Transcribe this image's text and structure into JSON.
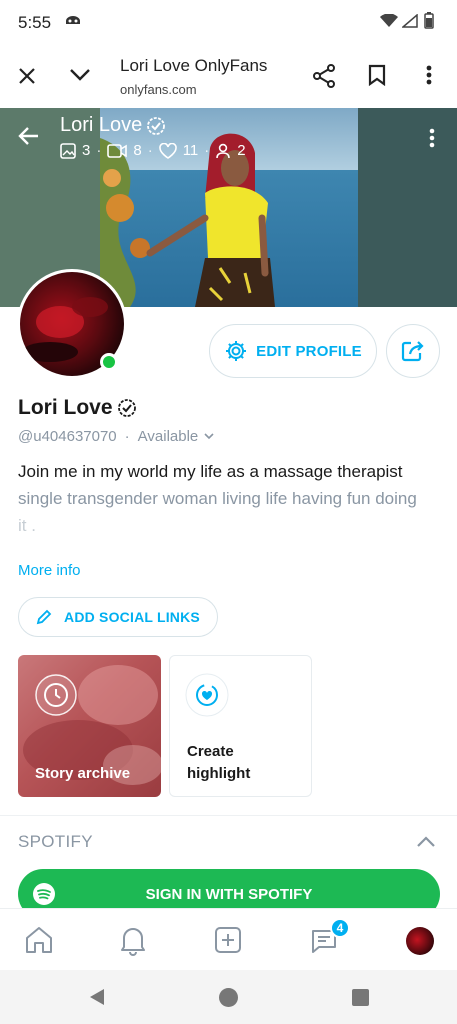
{
  "status_bar": {
    "time": "5:55"
  },
  "browser": {
    "page_title": "Lori Love OnlyFans",
    "url": "onlyfans.com",
    "icons": [
      "close-icon",
      "chevron-down-icon",
      "share-icon",
      "bookmark-icon",
      "more-vert-icon"
    ]
  },
  "cover": {
    "name": "Lori Love",
    "stats": {
      "photos": "3",
      "videos": "8",
      "likes": "11",
      "fans": "2"
    }
  },
  "profile": {
    "edit_label": "EDIT PROFILE",
    "name": "Lori Love",
    "handle": "@u404637070",
    "availability": "Available",
    "bio_line1": "Join me in my world my life as a massage therapist",
    "bio_line2": "single transgender woman living life having fun doing",
    "bio_line3": "it .",
    "more_info": "More info",
    "add_social": "ADD SOCIAL LINKS"
  },
  "highlights": {
    "story_archive": "Story archive",
    "create_highlight_line1": "Create",
    "create_highlight_line2": "highlight"
  },
  "spotify": {
    "section_title": "SPOTIFY",
    "sign_in": "SIGN IN WITH SPOTIFY"
  },
  "bottom_nav": {
    "messages_badge": "4"
  },
  "colors": {
    "accent": "#00aff0",
    "spotify": "#1db954",
    "online": "#18c443",
    "muted": "#8a96a3"
  }
}
